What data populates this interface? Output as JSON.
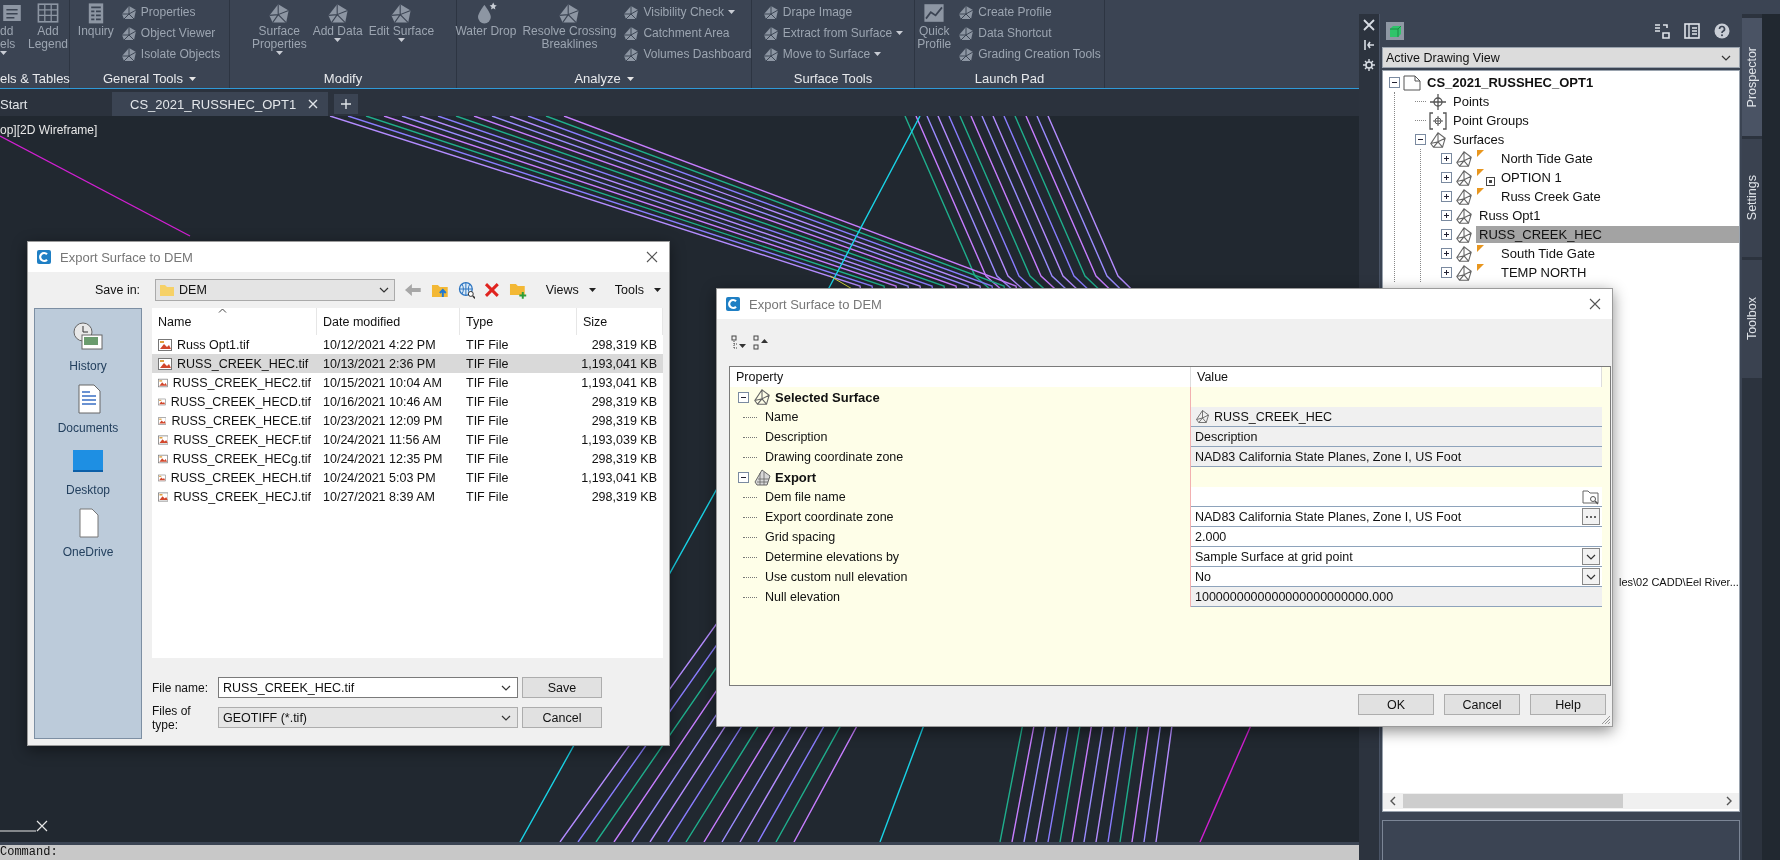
{
  "ribbon": {
    "panels": [
      {
        "title": "els & Tables",
        "dropdown": false,
        "tools": [
          {
            "kind": "large",
            "label": "dd\nels",
            "dropdown": true
          },
          {
            "kind": "large",
            "label": "Add\nLegend",
            "dropdown": false
          }
        ]
      },
      {
        "title": "General Tools",
        "dropdown": true,
        "tools": [
          {
            "kind": "large",
            "label": "Inquiry",
            "dropdown": false
          },
          {
            "kind": "small",
            "label": "Properties",
            "dropdown": false
          },
          {
            "kind": "small",
            "label": "Object Viewer",
            "dropdown": false
          },
          {
            "kind": "small",
            "label": "Isolate Objects",
            "dropdown": false
          }
        ]
      },
      {
        "title": "Modify",
        "dropdown": false,
        "tools": [
          {
            "kind": "large",
            "label": "Surface\nProperties",
            "dropdown": true
          },
          {
            "kind": "large",
            "label": "Add Data",
            "dropdown": true
          },
          {
            "kind": "large",
            "label": "Edit Surface",
            "dropdown": true
          }
        ]
      },
      {
        "title": "Analyze",
        "dropdown": true,
        "tools": [
          {
            "kind": "large",
            "label": "Water Drop",
            "dropdown": false
          },
          {
            "kind": "large",
            "label": "Resolve Crossing\nBreaklines",
            "dropdown": false
          },
          {
            "kind": "small",
            "label": "Visibility Check",
            "dropdown": true
          },
          {
            "kind": "small",
            "label": "Catchment Area",
            "dropdown": false
          },
          {
            "kind": "small",
            "label": "Volumes Dashboard",
            "dropdown": false
          }
        ]
      },
      {
        "title": "Surface Tools",
        "dropdown": false,
        "tools": [
          {
            "kind": "small",
            "label": "Drape Image",
            "dropdown": false
          },
          {
            "kind": "small",
            "label": "Extract from Surface",
            "dropdown": true
          },
          {
            "kind": "small",
            "label": "Move to Surface",
            "dropdown": true
          }
        ]
      },
      {
        "title": "Launch Pad",
        "dropdown": false,
        "tools": [
          {
            "kind": "large",
            "label": "Quick\nProfile",
            "dropdown": false
          },
          {
            "kind": "small",
            "label": "Create Profile",
            "dropdown": false
          },
          {
            "kind": "small",
            "label": "Data Shortcut",
            "dropdown": false
          },
          {
            "kind": "small",
            "label": "Grading Creation Tools",
            "dropdown": false
          }
        ]
      }
    ]
  },
  "tabs": [
    {
      "label": "Start",
      "selected": false,
      "closable": false
    },
    {
      "label": "CS_2021_RUSSHEC_OPT1",
      "selected": true,
      "closable": true
    }
  ],
  "viewport": {
    "label": "op][2D Wireframe]"
  },
  "command_line": {
    "prompt": "Command:"
  },
  "prospector": {
    "view": "Active Drawing View",
    "tree": [
      {
        "label": "CS_2021_RUSSHEC_OPT1",
        "kind": "drawing",
        "expanded": true,
        "selected": false,
        "children": [
          {
            "label": "Points",
            "kind": "points",
            "selected": false
          },
          {
            "label": "Point Groups",
            "kind": "point-groups",
            "selected": false
          },
          {
            "label": "Surfaces",
            "kind": "surfaces",
            "expanded": true,
            "selected": false,
            "children": [
              {
                "label": "North Tide Gate",
                "kind": "surface",
                "expanded": false,
                "selected": false,
                "flag": true,
                "reference": false
              },
              {
                "label": "OPTION 1",
                "kind": "surface",
                "expanded": false,
                "selected": false,
                "flag": true,
                "reference": true
              },
              {
                "label": "Russ Creek Gate",
                "kind": "surface",
                "expanded": false,
                "selected": false,
                "flag": true,
                "reference": false
              },
              {
                "label": "Russ Opt1",
                "kind": "surface",
                "expanded": false,
                "selected": false,
                "flag": false,
                "reference": false
              },
              {
                "label": "RUSS_CREEK_HEC",
                "kind": "surface",
                "expanded": false,
                "selected": true,
                "flag": false,
                "reference": false
              },
              {
                "label": "South Tide Gate",
                "kind": "surface",
                "expanded": false,
                "selected": false,
                "flag": true,
                "reference": false
              },
              {
                "label": "TEMP NORTH",
                "kind": "surface",
                "expanded": false,
                "selected": false,
                "flag": true,
                "reference": false
              }
            ]
          }
        ]
      }
    ],
    "path_text": "les\\02 CADD\\Eel River...",
    "side_tabs": [
      {
        "label": "Prospector",
        "selected": true
      },
      {
        "label": "Settings",
        "selected": false
      },
      {
        "label": "Toolbox",
        "selected": false
      }
    ]
  },
  "file_dialog": {
    "title": "Export Surface to DEM",
    "save_in_label": "Save in:",
    "save_in": "DEM",
    "menus": [
      "Views",
      "Tools"
    ],
    "places": [
      "History",
      "Documents",
      "Desktop",
      "OneDrive"
    ],
    "columns": [
      {
        "label": "Name",
        "sorted": true
      },
      {
        "label": "Date modified",
        "sorted": false
      },
      {
        "label": "Type",
        "sorted": false
      },
      {
        "label": "Size",
        "sorted": false
      }
    ],
    "rows": [
      {
        "name": "Russ Opt1.tif",
        "date": "10/12/2021 4:22 PM",
        "type": "TIF File",
        "size": "298,319 KB",
        "selected": false
      },
      {
        "name": "RUSS_CREEK_HEC.tif",
        "date": "10/13/2021 2:36 PM",
        "type": "TIF File",
        "size": "1,193,041 KB",
        "selected": true
      },
      {
        "name": "RUSS_CREEK_HEC2.tif",
        "date": "10/15/2021 10:04 AM",
        "type": "TIF File",
        "size": "1,193,041 KB",
        "selected": false
      },
      {
        "name": "RUSS_CREEK_HECD.tif",
        "date": "10/16/2021 10:46 AM",
        "type": "TIF File",
        "size": "298,319 KB",
        "selected": false
      },
      {
        "name": "RUSS_CREEK_HECE.tif",
        "date": "10/23/2021 12:09 PM",
        "type": "TIF File",
        "size": "298,319 KB",
        "selected": false
      },
      {
        "name": "RUSS_CREEK_HECF.tif",
        "date": "10/24/2021 11:56 AM",
        "type": "TIF File",
        "size": "1,193,039 KB",
        "selected": false
      },
      {
        "name": "RUSS_CREEK_HECg.tif",
        "date": "10/24/2021 12:35 PM",
        "type": "TIF File",
        "size": "298,319 KB",
        "selected": false
      },
      {
        "name": "RUSS_CREEK_HECH.tif",
        "date": "10/24/2021 5:03 PM",
        "type": "TIF File",
        "size": "1,193,041 KB",
        "selected": false
      },
      {
        "name": "RUSS_CREEK_HECJ.tif",
        "date": "10/27/2021 8:39 AM",
        "type": "TIF File",
        "size": "298,319 KB",
        "selected": false
      }
    ],
    "file_name_label": "File name:",
    "file_name": "RUSS_CREEK_HEC.tif",
    "file_type_label": "Files of type:",
    "file_type": "GEOTIFF (*.tif)",
    "buttons": [
      "Save",
      "Cancel"
    ]
  },
  "dem_dialog": {
    "title": "Export Surface to DEM",
    "columns": [
      "Property",
      "Value"
    ],
    "groups": [
      {
        "label": "Selected Surface",
        "kind": "surface",
        "expanded": true,
        "rows": [
          {
            "property": "Name",
            "value": "RUSS_CREEK_HEC",
            "kind": "surface"
          },
          {
            "property": "Description",
            "value": "Description",
            "kind": "readonly"
          },
          {
            "property": "Drawing coordinate zone",
            "value": "NAD83 California State Planes, Zone I, US Foot",
            "kind": "readonly"
          }
        ]
      },
      {
        "label": "Export",
        "kind": "export",
        "expanded": true,
        "rows": [
          {
            "property": "Dem file name",
            "kind": "browse"
          },
          {
            "property": "Export coordinate zone",
            "value": "NAD83 California State Planes, Zone I, US Foot",
            "kind": "ellipsis"
          },
          {
            "property": "Grid spacing",
            "value": "2.000",
            "kind": "text"
          },
          {
            "property": "Determine elevations by",
            "value": "Sample Surface at grid point",
            "kind": "dropdown"
          },
          {
            "property": "Use custom null elevation",
            "value": "No",
            "kind": "dropdown"
          },
          {
            "property": "Null elevation",
            "value": "1000000000000000000000000.000",
            "kind": "readonly"
          }
        ]
      }
    ],
    "buttons": [
      "OK",
      "Cancel",
      "Help"
    ]
  }
}
